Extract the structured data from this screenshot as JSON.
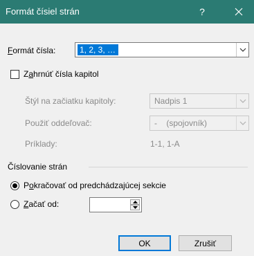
{
  "window": {
    "title": "Formát čísiel strán",
    "help_label": "?",
    "close_icon": "close-icon",
    "titlebar_color": "#2b7b73"
  },
  "format": {
    "label": "Formát čísla:",
    "accel": "F",
    "label_rest": "ormát čísla:",
    "value": "1, 2, 3, …",
    "dropdown_icon": "chevron-down-icon",
    "highlight_color": "#0078d7"
  },
  "chapter": {
    "include_label": "Zahrnúť čísla kapitol",
    "include_pre": "Z",
    "include_accel": "a",
    "include_rest": "hrnúť čísla kapitol",
    "include_checked": false,
    "style_label": "Štýl na začiatku kapitoly:",
    "style_value": "Nadpis 1",
    "separator_label": "Použiť oddeľovač:",
    "separator_value": "-    (spojovník)",
    "examples_label": "Príklady:",
    "examples_value": "1-1, 1-A"
  },
  "numbering": {
    "group_label": "Číslovanie strán",
    "continue_label": "Pokračovať od predchádzajúcej sekcie",
    "continue_pre": "P",
    "continue_accel": "o",
    "continue_rest": "kračovať od predchádzajúcej sekcie",
    "continue_selected": true,
    "start_label": "Začať od:",
    "start_accel": "Z",
    "start_rest": "ačať od:",
    "start_selected": false,
    "start_value": ""
  },
  "buttons": {
    "ok": "OK",
    "cancel": "Zrušiť"
  }
}
